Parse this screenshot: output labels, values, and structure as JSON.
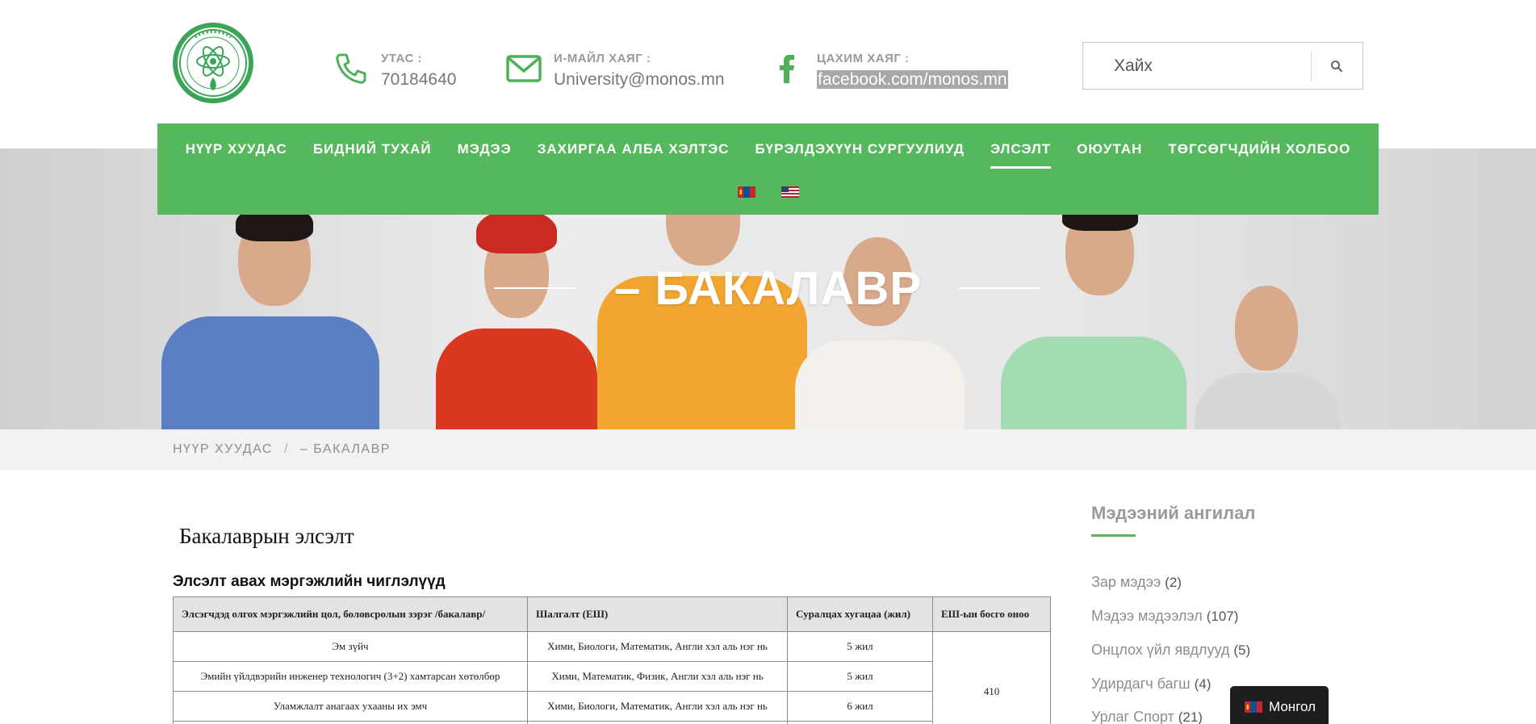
{
  "header": {
    "phone": {
      "label": "УТАС :",
      "value": "70184640"
    },
    "email": {
      "label": "И-МАЙЛ ХАЯГ :",
      "value": "University@monos.mn"
    },
    "social": {
      "label": "ЦАХИМ ХАЯГ :",
      "value": "facebook.com/monos.mn"
    },
    "search": {
      "placeholder": "Хайх"
    }
  },
  "nav": {
    "items": [
      {
        "label": "НҮҮР ХУУДАС",
        "active": false
      },
      {
        "label": "БИДНИЙ ТУХАЙ",
        "active": false
      },
      {
        "label": "МЭДЭЭ",
        "active": false
      },
      {
        "label": "ЗАХИРГАА АЛБА ХЭЛТЭС",
        "active": false
      },
      {
        "label": "БҮРЭЛДЭХҮҮН СУРГУУЛИУД",
        "active": false
      },
      {
        "label": "ЭЛСЭЛТ",
        "active": true
      },
      {
        "label": "ОЮУТАН",
        "active": false
      },
      {
        "label": "ТӨГСӨГЧДИЙН ХОЛБОО",
        "active": false
      }
    ],
    "flags": [
      "mongolia-flag",
      "usa-flag"
    ]
  },
  "hero": {
    "title": "– БАКАЛАВР"
  },
  "breadcrumb": {
    "home": "НҮҮР ХУУДАС",
    "separator": "/",
    "current": "– БАКАЛАВР"
  },
  "content": {
    "title": "Бакалаврын элсэлт",
    "section_title": "Элсэлт авах мэргэжлийн чиглэлүүд",
    "table": {
      "headers": [
        "Элсэгчдэд олгох мэргэжлийн цол, боловсролын зэрэг /бакалавр/",
        "Шалгалт (ЕШ)",
        "Суралцах хугацаа (жил)",
        "ЕШ-ын босго оноо"
      ],
      "rows": [
        [
          "Эм зүйч",
          "Хими, Биологи, Математик, Англи хэл аль нэг нь",
          "5 жил"
        ],
        [
          "Эмийн үйлдвэрийн инженер технологич (3+2) хамтарсан хөтөлбөр",
          "Хими, Математик, Физик, Англи хэл аль нэг нь",
          "5 жил"
        ],
        [
          "Уламжлалт анагаах ухааны их эмч",
          "Хими, Биологи, Математик, Англи хэл аль нэг нь",
          "6 жил"
        ]
      ],
      "threshold": "410"
    }
  },
  "sidebar": {
    "heading": "Мэдээний ангилал",
    "categories": [
      {
        "name": "Зар мэдээ",
        "count": "(2)"
      },
      {
        "name": "Мэдээ мэдээлэл",
        "count": "(107)"
      },
      {
        "name": "Онцлох үйл явдлууд",
        "count": "(5)"
      },
      {
        "name": "Удирдагч багш",
        "count": "(4)"
      },
      {
        "name": "Урлаг Спорт",
        "count": "(21)"
      }
    ]
  },
  "language_switcher": {
    "label": "Монгол"
  },
  "colors": {
    "brand_green": "#55b85c",
    "breadcrumb_bg": "#f2f2f2",
    "text_gray": "#8e8e8e"
  }
}
